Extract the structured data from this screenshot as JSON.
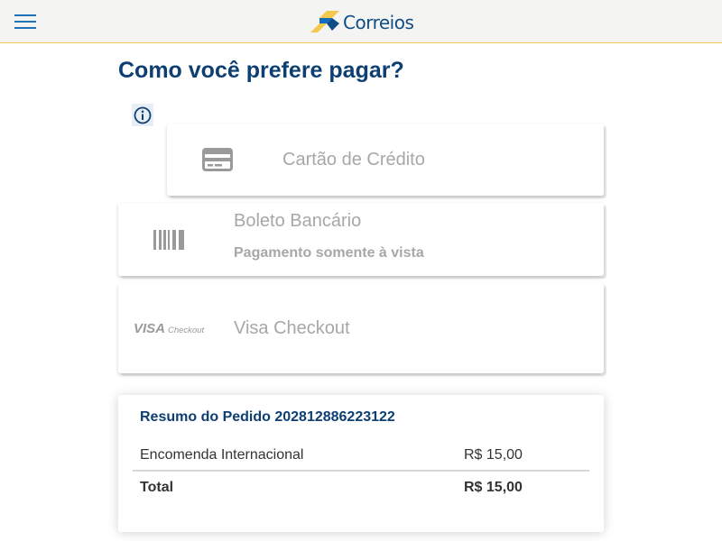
{
  "header": {
    "menu_icon": "hamburger-menu-icon",
    "brand_name": "Correios",
    "colors": {
      "bar": "#f4f4f2",
      "brand_blue": "#0f4d87",
      "brand_yellow": "#f2c94c",
      "menu_blue": "#1f72b8"
    }
  },
  "page": {
    "title": "Como você prefere pagar?",
    "info_icon": "info-circle-icon",
    "title_color": "#0d3f73"
  },
  "payment_options": {
    "credit": {
      "label": "Cartão de Crédito",
      "icon": "credit-card-icon"
    },
    "boleto": {
      "label": "Boleto Bancário",
      "note": "Pagamento somente à vista",
      "icon": "barcode-icon"
    },
    "visa": {
      "label": "Visa Checkout",
      "icon": "visa-checkout-logo",
      "logo_text": "VISA Checkout"
    }
  },
  "summary": {
    "title": "Resumo do Pedido 202812886223122",
    "items": [
      {
        "description": "Encomenda Internacional",
        "value": "R$ 15,00"
      }
    ],
    "total_label": "Total",
    "total_value": "R$ 15,00"
  }
}
